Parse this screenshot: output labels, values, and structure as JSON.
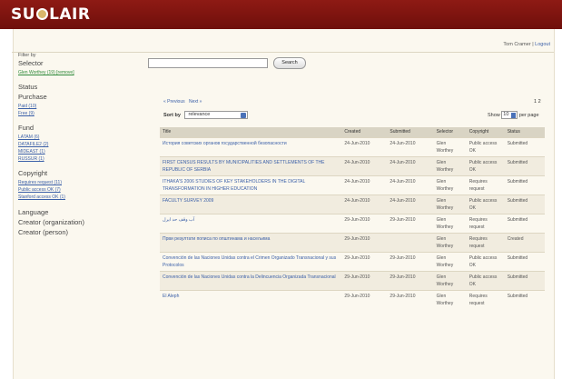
{
  "brand": {
    "logo_text_left": "SU",
    "logo_text_right": "LAIR"
  },
  "userbar": {
    "user": "Tom Cramer",
    "separator": " | ",
    "logout": "Logout"
  },
  "sidebar": {
    "filter_by": "Filter by",
    "selector": {
      "title": "Selector",
      "items": [
        {
          "label": "Glen Worthey (19) [remove]"
        }
      ]
    },
    "status": {
      "title": "Status",
      "sub": "Purchase",
      "items": [
        {
          "label": "Paid (10)"
        },
        {
          "label": "Free (9)"
        }
      ]
    },
    "fund": {
      "title": "Fund",
      "items": [
        {
          "label": "LATAM (6)"
        },
        {
          "label": "DATAFILE2 (2)"
        },
        {
          "label": "MIDEAST (1)"
        },
        {
          "label": "RUSSUR (1)"
        }
      ]
    },
    "copyright": {
      "title": "Copyright",
      "items": [
        {
          "label": "Requires request (11)"
        },
        {
          "label": "Public access OK (7)"
        },
        {
          "label": "Stanford access OK (1)"
        }
      ]
    },
    "extra": [
      {
        "label": "Language"
      },
      {
        "label": "Creator (organization)"
      },
      {
        "label": "Creator (person)"
      }
    ]
  },
  "search": {
    "value": "",
    "button": "Search"
  },
  "pager": {
    "previous": "« Previous",
    "next": "Next »",
    "pages": "1 2"
  },
  "sort": {
    "label": "Sort by",
    "value": "relevance"
  },
  "show": {
    "label": "Show",
    "value": "10",
    "suffix": "per page"
  },
  "table": {
    "headers": [
      "Title",
      "Created",
      "Submitted",
      "Selector",
      "Copyright",
      "Status"
    ],
    "rows": [
      {
        "title": "История советских органов государственной безопасности",
        "created": "24-Jun-2010",
        "submitted": "24-Jun-2010",
        "selector": "Glen Worthey",
        "copyright": "Public access OK",
        "status": "Submitted"
      },
      {
        "title": "FIRST CENSUS RESULTS BY MUNICIPALITIES AND SETTLEMENTS OF THE REPUBLIC OF SERBIA",
        "created": "24-Jun-2010",
        "submitted": "24-Jun-2010",
        "selector": "Glen Worthey",
        "copyright": "Public access OK",
        "status": "Submitted"
      },
      {
        "title": "ITHAKA'S 2006 STUDIES OF KEY STAKEHOLDERS IN THE DIGITAL TRANSFORMATION IN HIGHER EDUCATION",
        "created": "24-Jun-2010",
        "submitted": "24-Jun-2010",
        "selector": "Glen Worthey",
        "copyright": "Requires request",
        "status": "Submitted"
      },
      {
        "title": "FACULTY SURVEY 2009",
        "created": "24-Jun-2010",
        "submitted": "24-Jun-2010",
        "selector": "Glen Worthey",
        "copyright": "Public access OK",
        "status": "Submitted"
      },
      {
        "title": "آب وقف حد ايرل",
        "created": "29-Jun-2010",
        "submitted": "29-Jun-2010",
        "selector": "Glen Worthey",
        "copyright": "Requires request",
        "status": "Submitted"
      },
      {
        "title": "Први резултати пописа по општинама и насељима",
        "created": "29-Jun-2010",
        "submitted": "",
        "selector": "Glen Worthey",
        "copyright": "Requires request",
        "status": "Created"
      },
      {
        "title": "Convención de las Naciones Unidas contra el Crimen Organizado Transnacional y sus Protocolos",
        "created": "29-Jun-2010",
        "submitted": "29-Jun-2010",
        "selector": "Glen Worthey",
        "copyright": "Public access OK",
        "status": "Submitted"
      },
      {
        "title": "Convención de las Naciones Unidas contra la Delincuencia Organizada Transnacional",
        "created": "29-Jun-2010",
        "submitted": "29-Jun-2010",
        "selector": "Glen Worthey",
        "copyright": "Public access OK",
        "status": "Submitted"
      },
      {
        "title": "El Aleph",
        "created": "29-Jun-2010",
        "submitted": "29-Jun-2010",
        "selector": "Glen Worthey",
        "copyright": "Requires request",
        "status": "Submitted"
      }
    ]
  }
}
